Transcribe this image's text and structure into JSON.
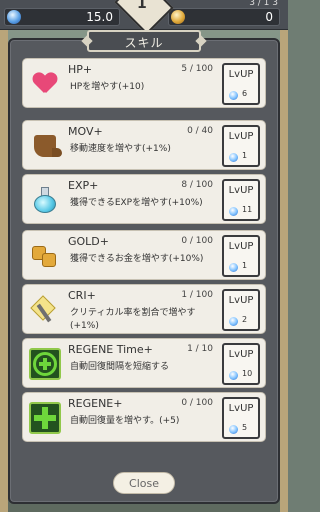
{
  "header": {
    "level": "1",
    "top_right_fragment": "3 / 1 3",
    "crystal_value": "15.0",
    "gold_value": "0"
  },
  "panel": {
    "title": "スキル",
    "close_label": "Close"
  },
  "lvup_label": "LvUP",
  "skills": [
    {
      "name": "HP+",
      "count": "5 / 100",
      "desc": "HPを増やす(+10)",
      "cost": "6",
      "icon": "heart-icon"
    },
    {
      "name": "MOV+",
      "count": "0 / 40",
      "desc": "移動速度を増やす(+1%)",
      "cost": "1",
      "icon": "boot-icon"
    },
    {
      "name": "EXP+",
      "count": "8 / 100",
      "desc": "獲得できるEXPを増やす(+10%)",
      "cost": "11",
      "icon": "potion-icon"
    },
    {
      "name": "GOLD+",
      "count": "0 / 100",
      "desc": "獲得できるお金を増やす(+10%)",
      "cost": "1",
      "icon": "coins-icon"
    },
    {
      "name": "CRI+",
      "count": "1 / 100",
      "desc": "クリティカル率を割合で増やす(+1%)",
      "cost": "2",
      "icon": "critical-sword-icon"
    },
    {
      "name": "REGENE Time+",
      "count": "1 / 10",
      "desc": "自動回復間隔を短縮する",
      "cost": "10",
      "icon": "regen-timer-icon"
    },
    {
      "name": "REGENE+",
      "count": "0 / 100",
      "desc": "自動回復量を増やす。(+5)",
      "cost": "5",
      "icon": "regen-cross-icon"
    }
  ],
  "colors": {
    "panel_bg": "#56595e",
    "row_bg": "#f1eee7",
    "regen_green": "#6ed63b"
  }
}
